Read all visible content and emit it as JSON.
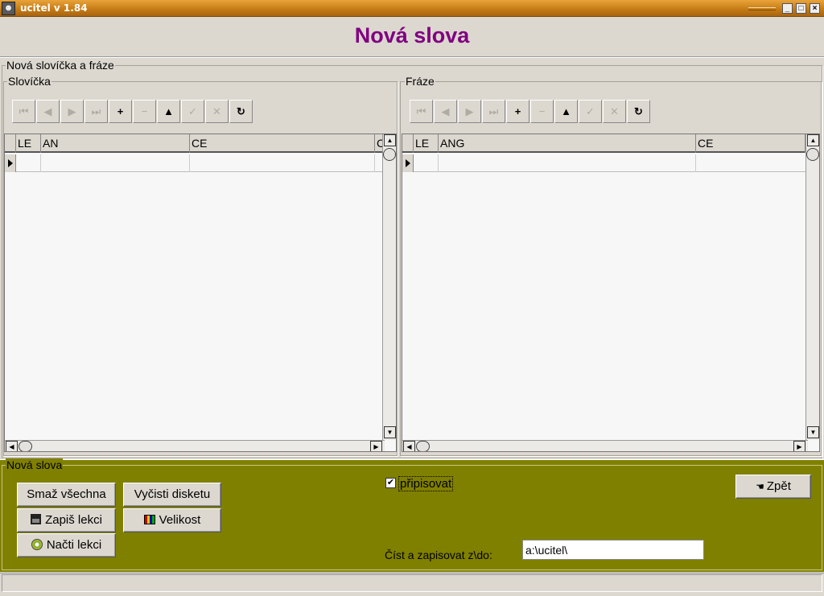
{
  "window": {
    "title": "ucitel v 1.84",
    "controls": [
      "minimize",
      "maximize",
      "close"
    ]
  },
  "header": {
    "title": "Nová slova"
  },
  "main_group": {
    "label": "Nová slovíčka a fráze"
  },
  "words": {
    "label": "Slovíčka",
    "columns": [
      "LE",
      "AN",
      "CE",
      "C"
    ],
    "rows": [
      [
        "",
        "",
        "",
        ""
      ]
    ]
  },
  "phrases": {
    "label": "Fráze",
    "columns": [
      "LE",
      "ANG",
      "CE"
    ],
    "rows": [
      [
        "",
        "",
        ""
      ]
    ]
  },
  "navigator": {
    "buttons": [
      {
        "icon": "first-record-icon",
        "glyph": "⏮",
        "enabled": false
      },
      {
        "icon": "prior-record-icon",
        "glyph": "◀",
        "enabled": false
      },
      {
        "icon": "next-record-icon",
        "glyph": "▶",
        "enabled": false
      },
      {
        "icon": "last-record-icon",
        "glyph": "⏭",
        "enabled": false
      },
      {
        "icon": "insert-icon",
        "glyph": "+",
        "enabled": true
      },
      {
        "icon": "delete-icon",
        "glyph": "−",
        "enabled": false
      },
      {
        "icon": "edit-icon",
        "glyph": "▲",
        "enabled": true
      },
      {
        "icon": "post-icon",
        "glyph": "✓",
        "enabled": false
      },
      {
        "icon": "cancel-icon",
        "glyph": "✕",
        "enabled": false
      },
      {
        "icon": "refresh-icon",
        "glyph": "↻",
        "enabled": true
      }
    ]
  },
  "bottom": {
    "label": "Nová slova",
    "bg_color": "#808000",
    "buttons": {
      "delete_all": "Smaž všechna",
      "save_lesson": "Zapiš lekci",
      "load_lesson": "Načti lekci",
      "clear_disk": "Vyčisti disketu",
      "size": "Velikost",
      "back": "Zpět"
    },
    "append_checkbox": {
      "label": "připisovat",
      "checked": true
    },
    "path": {
      "label": "Číst a zapisovat z\\do:",
      "value": "a:\\ucitel\\"
    }
  },
  "colors": {
    "title_bar": "#c47a14",
    "page_title": "#800080",
    "panel_bg": "#dcd8d0"
  }
}
